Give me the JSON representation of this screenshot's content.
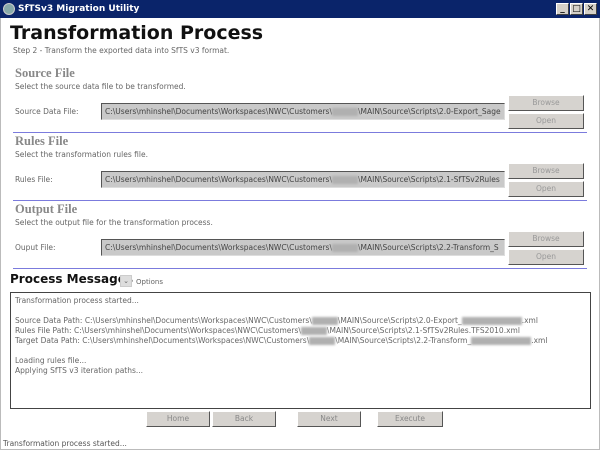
{
  "window": {
    "title": "SfTSv3 Migration Utility",
    "minimize": "_",
    "maximize": "□",
    "close": "✕"
  },
  "page": {
    "title": "Transformation Process",
    "step": "Step 2 - Transform the exported data into SfTS v3 format."
  },
  "sections": [
    {
      "heading": "Source File",
      "description": "Select the source data file to be transformed.",
      "label": "Source Data File:",
      "path_prefix": "C:\\Users\\mhinshel\\Documents\\Workspaces\\NWC\\Customers\\",
      "path_suffix": "\\MAIN\\Source\\Scripts\\2.0-Export_Sage",
      "browse": "Browse",
      "open": "Open"
    },
    {
      "heading": "Rules File",
      "description": "Select the transformation rules file.",
      "label": "Rules File:",
      "path_prefix": "C:\\Users\\mhinshel\\Documents\\Workspaces\\NWC\\Customers\\",
      "path_suffix": "\\MAIN\\Source\\Scripts\\2.1-SfTSv2Rules",
      "browse": "Browse",
      "open": "Open"
    },
    {
      "heading": "Output File",
      "description": "Select the output file for the transformation process.",
      "label": "Ouput File:",
      "path_prefix": "C:\\Users\\mhinshel\\Documents\\Workspaces\\NWC\\Customers\\",
      "path_suffix": "\\MAIN\\Source\\Scripts\\2.2-Transform_S",
      "browse": "Browse",
      "open": "Open"
    }
  ],
  "messages": {
    "title": "Process Messages",
    "options": "Options",
    "lines": [
      {
        "a": "Transformation process started..."
      },
      {
        "a": ""
      },
      {
        "a": "Source Data Path: C:\\Users\\mhinshel\\Documents\\Workspaces\\NWC\\Customers\\",
        "b": "\\MAIN\\Source\\Scripts\\2.0-Export_",
        "c": ".xml"
      },
      {
        "a": "Rules File Path: C:\\Users\\mhinshel\\Documents\\Workspaces\\NWC\\Customers\\",
        "b": "\\MAIN\\Source\\Scripts\\2.1-SfTSv2Rules.TFS2010.xml"
      },
      {
        "a": "Target Data Path: C:\\Users\\mhinshel\\Documents\\Workspaces\\NWC\\Customers\\",
        "b": "\\MAIN\\Source\\Scripts\\2.2-Transform_",
        "c": ".xml"
      },
      {
        "a": ""
      },
      {
        "a": "Loading rules file..."
      },
      {
        "a": "Applying SfTS v3 iteration paths..."
      }
    ]
  },
  "nav": {
    "home": "Home",
    "back": "Back",
    "next": "Next",
    "execute": "Execute"
  },
  "status": "Transformation process started..."
}
